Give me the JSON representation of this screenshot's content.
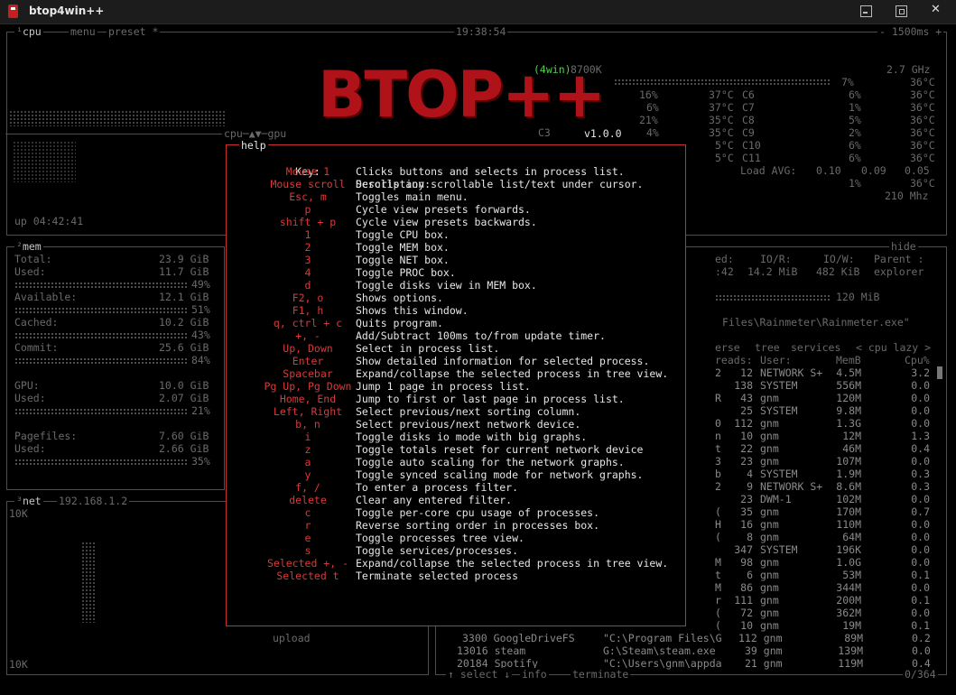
{
  "window": {
    "title": "btop4win++"
  },
  "cpu": {
    "label_num": "¹",
    "label": "cpu",
    "menu": "menu",
    "preset": "preset *",
    "clock": "19:38:54",
    "interval": "- 1500ms +",
    "freq": "2.7 GHz",
    "cpu_model_tag": "8700K",
    "uptime": "up 04:42:41",
    "cpu_gpu_tab": "cpu─▲▼─gpu",
    "load_label": "Load AVG:",
    "load": [
      "0.10",
      "0.09",
      "0.05"
    ],
    "gpu_freq": "210 Mhz",
    "gpu_pct": "1%",
    "gpu_temp": "36°C",
    "cores_left": [
      {
        "pct": "16%",
        "temp": "37°C"
      },
      {
        "pct": "6%",
        "temp": "37°C"
      },
      {
        "pct": "21%",
        "temp": "35°C"
      },
      {
        "pct": "4%",
        "temp": "35°C"
      },
      {
        "pct": "",
        "temp": "5°C"
      },
      {
        "pct": "",
        "temp": "5°C"
      }
    ],
    "cores_right": [
      {
        "name": "C6",
        "pct": "6%",
        "temp": "36°C"
      },
      {
        "name": "C7",
        "pct": "1%",
        "temp": "36°C"
      },
      {
        "name": "C8",
        "pct": "5%",
        "temp": "36°C"
      },
      {
        "name": "C9",
        "pct": "2%",
        "temp": "36°C"
      },
      {
        "name": "C10",
        "pct": "6%",
        "temp": "36°C"
      },
      {
        "name": "C11",
        "pct": "6%",
        "temp": "36°C"
      }
    ],
    "total_pct": "7%",
    "total_temp": "36°C",
    "c3": "C3"
  },
  "logo": {
    "text": "BTOP++",
    "tag": "(4win)",
    "version": "v1.0.0"
  },
  "mem": {
    "label_num": "²",
    "label": "mem",
    "total_label": "Total:",
    "total": "23.9 GiB",
    "used_label": "Used:",
    "used": "11.7 GiB",
    "used_pct": "49%",
    "avail_label": "Available:",
    "avail": "12.1 GiB",
    "avail_pct": "51%",
    "cached_label": "Cached:",
    "cached": "10.2 GiB",
    "cached_pct": "43%",
    "commit_label": "Commit:",
    "commit": "25.6 GiB",
    "commit_pct": "84%",
    "gpu_label": "GPU:",
    "gpu": "10.0 GiB",
    "gpu_used_label": "Used:",
    "gpu_used": "2.07 GiB",
    "gpu_pct": "21%",
    "page_label": "Pagefiles:",
    "page": "7.60 GiB",
    "page_used_label": "Used:",
    "page_used": "2.66 GiB",
    "page_pct": "35%"
  },
  "net": {
    "label_num": "³",
    "label": "net",
    "ip": "192.168.1.2",
    "top": "10K",
    "bottom": "10K",
    "upload": "upload"
  },
  "proc_detail": {
    "h_ed": "ed:",
    "h_ior": "IO/R:",
    "h_iow": "IO/W:",
    "h_parent": "Parent :",
    "hide": "hide",
    "v_time": ":42",
    "v_ior": "14.2 MiB",
    "v_iow": "482 KiB",
    "v_parent": "explorer",
    "mem": "120 MiB",
    "cmd": "Files\\Rainmeter\\Rainmeter.exe\""
  },
  "proc": {
    "tabs": [
      "erse",
      "tree",
      "services"
    ],
    "sort": "< cpu lazy >",
    "h_reads": "reads:",
    "h_user": "User:",
    "h_memb": "MemB",
    "h_cpu": "Cpu%",
    "rows": [
      [
        "2",
        "12",
        "NETWORK S+",
        "4.5M",
        "3.2"
      ],
      [
        "",
        "138",
        "SYSTEM",
        "556M",
        "0.0"
      ],
      [
        "R",
        "43",
        "gnm",
        "120M",
        "0.0"
      ],
      [
        "",
        "25",
        "SYSTEM",
        "9.8M",
        "0.0"
      ],
      [
        "0",
        "112",
        "gnm",
        "1.3G",
        "0.0"
      ],
      [
        "n",
        "10",
        "gnm",
        "12M",
        "1.3"
      ],
      [
        "t",
        "22",
        "gnm",
        "46M",
        "0.4"
      ],
      [
        "3",
        "23",
        "gnm",
        "107M",
        "0.0"
      ],
      [
        "b",
        "4",
        "SYSTEM",
        "1.9M",
        "0.3"
      ],
      [
        "2",
        "9",
        "NETWORK S+",
        "8.6M",
        "0.3"
      ],
      [
        "",
        "23",
        "DWM-1",
        "102M",
        "0.0"
      ],
      [
        "(",
        "35",
        "gnm",
        "170M",
        "0.7"
      ],
      [
        "H",
        "16",
        "gnm",
        "110M",
        "0.0"
      ],
      [
        "(",
        "8",
        "gnm",
        "64M",
        "0.0"
      ],
      [
        "",
        "347",
        "SYSTEM",
        "196K",
        "0.0"
      ],
      [
        "M",
        "98",
        "gnm",
        "1.0G",
        "0.0"
      ],
      [
        "t",
        "6",
        "gnm",
        "53M",
        "0.1"
      ],
      [
        "M",
        "86",
        "gnm",
        "344M",
        "0.0"
      ],
      [
        "r",
        "111",
        "gnm",
        "200M",
        "0.1"
      ],
      [
        "(",
        "72",
        "gnm",
        "362M",
        "0.0"
      ],
      [
        "(",
        "10",
        "gnm",
        "19M",
        "0.1"
      ]
    ],
    "tail": [
      {
        "pid": "3300",
        "name": "GoogleDriveFS",
        "cmd": "\"C:\\Program Files\\G",
        "thr": "112",
        "user": "gnm",
        "mem": "89M",
        "cpu": "0.2"
      },
      {
        "pid": "13016",
        "name": "steam",
        "cmd": "G:\\Steam\\steam.exe",
        "thr": "39",
        "user": "gnm",
        "mem": "139M",
        "cpu": "0.0"
      },
      {
        "pid": "20184",
        "name": "Spotify",
        "cmd": "\"C:\\Users\\gnm\\appda",
        "thr": "21",
        "user": "gnm",
        "mem": "119M",
        "cpu": "0.4"
      }
    ],
    "footer": [
      "↑ select ↓",
      "info",
      "terminate"
    ],
    "count": "0/364"
  },
  "help": {
    "title": "help",
    "key_header": "Key:",
    "desc_header": "Description:",
    "rows": [
      [
        "Mouse 1",
        "Clicks buttons and selects in process list."
      ],
      [
        "Mouse scroll",
        "Scrolls any scrollable list/text under cursor."
      ],
      [
        "Esc, m",
        "Toggles main menu."
      ],
      [
        "p",
        "Cycle view presets forwards."
      ],
      [
        "shift + p",
        "Cycle view presets backwards."
      ],
      [
        "1",
        "Toggle CPU box."
      ],
      [
        "2",
        "Toggle MEM box."
      ],
      [
        "3",
        "Toggle NET box."
      ],
      [
        "4",
        "Toggle PROC box."
      ],
      [
        "d",
        "Toggle disks view in MEM box."
      ],
      [
        "F2, o",
        "Shows options."
      ],
      [
        "F1, h",
        "Shows this window."
      ],
      [
        "q, ctrl + c",
        "Quits program."
      ],
      [
        "+, -",
        "Add/Subtract 100ms to/from update timer."
      ],
      [
        "Up, Down",
        "Select in process list."
      ],
      [
        "Enter",
        "Show detailed information for selected process."
      ],
      [
        "Spacebar",
        "Expand/collapse the selected process in tree view."
      ],
      [
        "Pg Up, Pg Down",
        "Jump 1 page in process list."
      ],
      [
        "Home, End",
        "Jump to first or last page in process list."
      ],
      [
        "Left, Right",
        "Select previous/next sorting column."
      ],
      [
        "b, n",
        "Select previous/next network device."
      ],
      [
        "i",
        "Toggle disks io mode with big graphs."
      ],
      [
        "z",
        "Toggle totals reset for current network device"
      ],
      [
        "a",
        "Toggle auto scaling for the network graphs."
      ],
      [
        "y",
        "Toggle synced scaling mode for network graphs."
      ],
      [
        "f, /",
        "To enter a process filter."
      ],
      [
        "delete",
        "Clear any entered filter."
      ],
      [
        "c",
        "Toggle per-core cpu usage of processes."
      ],
      [
        "r",
        "Reverse sorting order in processes box."
      ],
      [
        "e",
        "Toggle processes tree view."
      ],
      [
        "s",
        "Toggle services/processes."
      ],
      [
        "Selected +, -",
        "Expand/collapse the selected process in tree view."
      ],
      [
        "Selected t",
        "Terminate selected process"
      ]
    ]
  }
}
